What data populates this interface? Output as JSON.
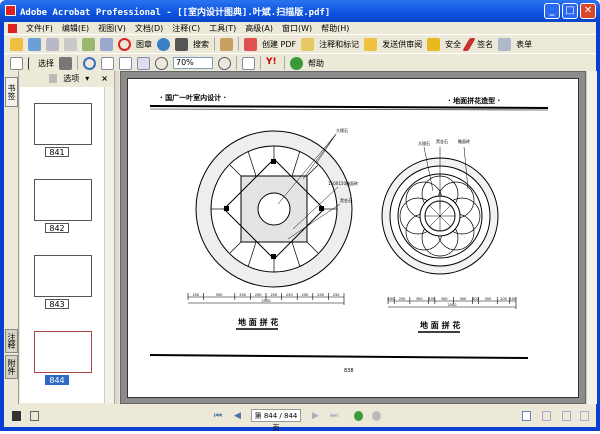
{
  "window": {
    "title": "Adobe Acrobat Professional - [[室内设计图典].叶斌.扫描版.pdf]",
    "minimize": "_",
    "maximize": "□",
    "close": "✕"
  },
  "menu": [
    "文件(F)",
    "编辑(E)",
    "视图(V)",
    "文档(D)",
    "注释(C)",
    "工具(T)",
    "高级(A)",
    "窗口(W)",
    "帮助(H)"
  ],
  "toolbar1": {
    "stamp": "图章",
    "search": "搜索",
    "create_pdf": "创建 PDF",
    "comment": "注释和标记",
    "review": "发送供审阅",
    "security": "安全",
    "sign": "签名",
    "forms": "表单"
  },
  "toolbar2": {
    "select": "选择",
    "zoom_value": "70%",
    "help": "帮助"
  },
  "nav": {
    "options": "选项",
    "close": "×",
    "tabs": [
      "书签",
      "注释",
      "附件"
    ],
    "thumbnails": [
      {
        "label": "841"
      },
      {
        "label": "842"
      },
      {
        "label": "843"
      },
      {
        "label": "844",
        "selected": true
      }
    ]
  },
  "document": {
    "header_left": "· 国广一叶室内设计 ·",
    "header_right": "· 地面拼花造型 ·",
    "caption_left": "地 面 拼 花",
    "caption_right": "地 面 拼 花",
    "page_number": "838",
    "labels_left": [
      "大理石",
      "150X150釉面砖",
      "黑金石"
    ],
    "labels_right": [
      "大理石",
      "黑金石",
      "釉面砖"
    ],
    "dims_left": [
      "250",
      "500",
      "250",
      "250",
      "250",
      "250",
      "250",
      "250",
      "250"
    ],
    "total_left": "2500",
    "dims_right": [
      "100",
      "250",
      "300",
      "100",
      "300",
      "300",
      "100",
      "300",
      "200",
      "100"
    ],
    "total_right": "2500"
  },
  "status": {
    "page_display": "第 844 / 844 页"
  },
  "colors": {
    "title_bar": "#0d52dd",
    "chrome": "#ece9d8",
    "doc_bg": "#8c8c8c",
    "selection": "#316ac5"
  }
}
